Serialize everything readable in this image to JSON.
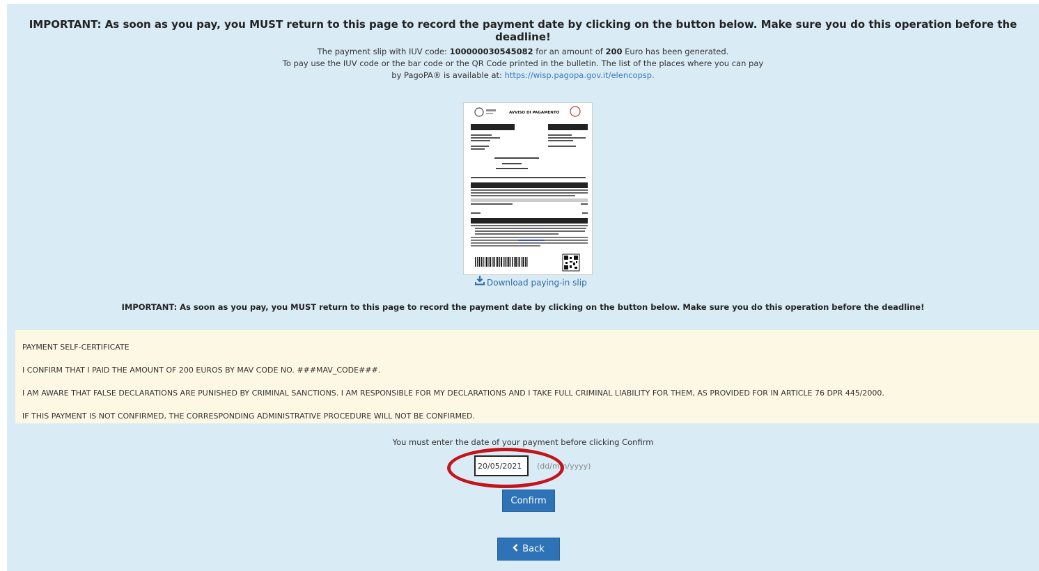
{
  "important_text": "IMPORTANT: As soon as you pay, you MUST return to this page to record the payment date by clicking on the button below. Make sure you do this operation before the deadline!",
  "slip_info": {
    "line1_prefix": "The payment slip with IUV code: ",
    "iuv_code": "100000030545082",
    "line1_mid": " for an amount of ",
    "amount": "200",
    "line1_suffix": " Euro has been generated.",
    "line2": "To pay use the IUV code or the bar code or the QR Code printed in the bulletin. The list of the places where you can pay",
    "line3_prefix": "by PagoPA® is available at: ",
    "link": "https://wisp.pagopa.gov.it/elencopsp."
  },
  "slip_preview": {
    "header_title": "AVVISO DI PAGAMENTO"
  },
  "download_label": "Download paying-in slip",
  "certificate": {
    "title": "PAYMENT SELF-CERTIFICATE",
    "line1": "I CONFIRM THAT I PAID THE AMOUNT OF 200 EUROS BY MAV CODE NO. ###MAV_CODE###.",
    "line2": "I AM AWARE THAT FALSE DECLARATIONS ARE PUNISHED BY CRIMINAL SANCTIONS. I AM RESPONSIBLE FOR MY DECLARATIONS AND I TAKE FULL CRIMINAL LIABILITY FOR THEM, AS PROVIDED FOR IN ARTICLE 76 DPR 445/2000.",
    "line3": "IF THIS PAYMENT IS NOT CONFIRMED, THE CORRESPONDING ADMINISTRATIVE PROCEDURE WILL NOT BE CONFIRMED."
  },
  "date_prompt": "You must enter the date of your payment before clicking Confirm",
  "date_field": {
    "value": "20/05/2021",
    "format_hint": "(dd/mm/yyyy)"
  },
  "buttons": {
    "confirm": "Confirm",
    "back": "Back"
  },
  "colors": {
    "panel": "#d9ebf5",
    "certificate_bg": "#fdf8e4",
    "button": "#2e72b8",
    "annotation_circle": "#c4141b",
    "link": "#3a7bbf"
  },
  "icons": {
    "download": "download-icon",
    "back": "chevron-left-icon"
  }
}
